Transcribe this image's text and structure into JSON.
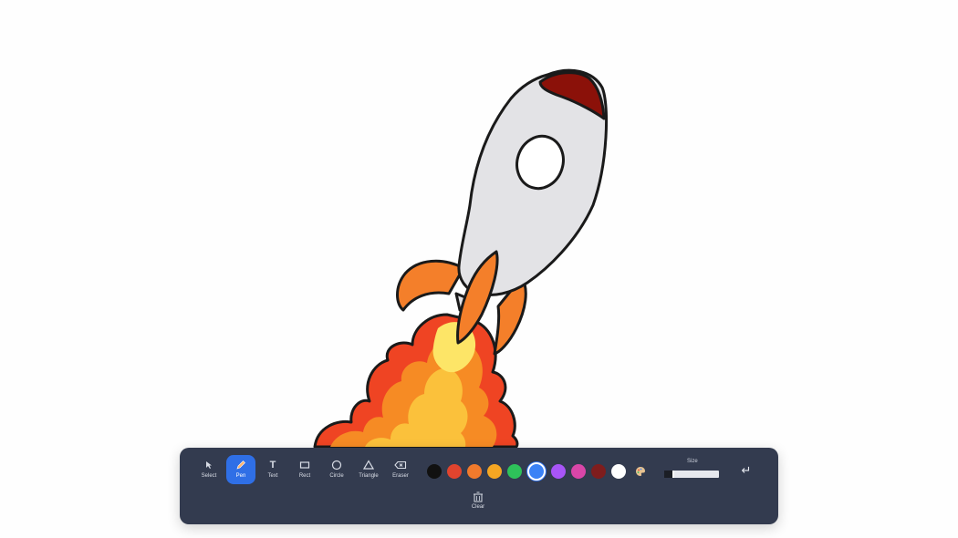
{
  "canvas": {
    "background": "#fefefe"
  },
  "toolbar": {
    "tools": [
      {
        "id": "select",
        "label": "Select",
        "icon": "cursor-icon"
      },
      {
        "id": "pen",
        "label": "Pen",
        "icon": "pen-icon",
        "active": true
      },
      {
        "id": "text",
        "label": "Text",
        "icon": "text-icon"
      },
      {
        "id": "rect",
        "label": "Rect",
        "icon": "rectangle-icon"
      },
      {
        "id": "circle",
        "label": "Circle",
        "icon": "circle-icon"
      },
      {
        "id": "triangle",
        "label": "Triangle",
        "icon": "triangle-icon"
      },
      {
        "id": "eraser",
        "label": "Eraser",
        "icon": "eraser-icon"
      }
    ],
    "colors": [
      "#111111",
      "#e0442e",
      "#f07a2c",
      "#f5a623",
      "#2ec25a",
      "#3b82f6",
      "#a855f7",
      "#d946a8",
      "#7f1d1d",
      "#ffffff"
    ],
    "selected_color": "#3b82f6",
    "palette_icon": "palette-icon",
    "size": {
      "label": "Size",
      "value_fraction": 0.15
    },
    "undo_icon": "undo-icon",
    "clear": {
      "label": "Clear",
      "icon": "trash-icon"
    }
  },
  "drawing": {
    "colors": {
      "outline": "#1a1a1a",
      "body": "#e3e3e6",
      "nose": "#8b1109",
      "fin": "#f47f2a",
      "flame_outer": "#ef4423",
      "flame_mid": "#f68b24",
      "flame_inner": "#fbc13b",
      "flame_core": "#fde567"
    }
  }
}
